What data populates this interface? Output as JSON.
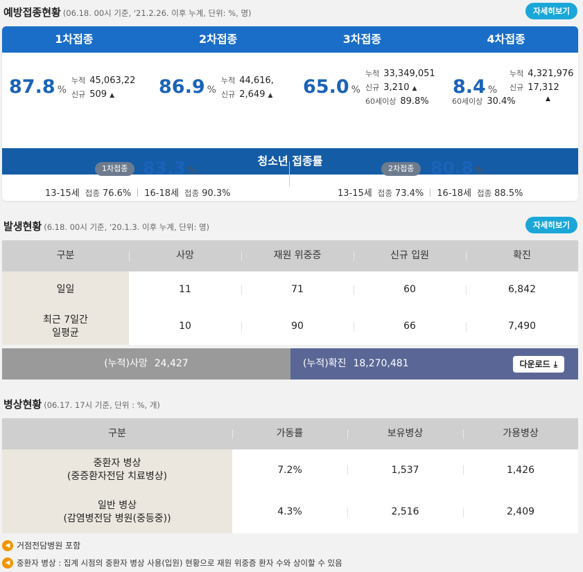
{
  "vaccination": {
    "title": "예방접종현황",
    "subtitle": "(06.18. 00시 기준, '21.2.26. 이후 누계, 단위: %, 명)",
    "detail_label": "자세히보기",
    "doses": [
      {
        "label": "1차접종",
        "rate": "87.8",
        "pct": "%",
        "cum_label": "누적",
        "cum": "45,063,22",
        "new_label": "신규",
        "new": "509"
      },
      {
        "label": "2차접종",
        "rate": "86.9",
        "pct": "%",
        "cum_label": "누적",
        "cum": "44,616,",
        "new_label": "신규",
        "new": "2,649"
      },
      {
        "label": "3차접종",
        "rate": "65.0",
        "pct": "%",
        "cum_label": "누적",
        "cum": "33,349,051",
        "new_label": "신규",
        "new": "3,210",
        "age_label": "60세이상",
        "age_rate": "89.8%"
      },
      {
        "label": "4차접종",
        "rate": "8.4",
        "pct": "%",
        "cum_label": "누적",
        "cum": "4,321,976",
        "new_label": "신규",
        "new": "17,312",
        "age_label": "60세이상",
        "age_rate": "30.4%"
      }
    ],
    "teen": {
      "title": "청소년 접종률",
      "groups": [
        {
          "badge": "1차접종",
          "rate": "83.3",
          "pct": "%",
          "a_age": "13-15세",
          "a_lbl": "접종",
          "a_val": "76.6%",
          "b_age": "16-18세",
          "b_lbl": "접종",
          "b_val": "90.3%"
        },
        {
          "badge": "2차접종",
          "rate": "80.8",
          "pct": "%",
          "a_age": "13-15세",
          "a_lbl": "접종",
          "a_val": "73.4%",
          "b_age": "16-18세",
          "b_lbl": "접종",
          "b_val": "88.5%"
        }
      ]
    }
  },
  "occurrence": {
    "title": "발생현황",
    "subtitle": "(6.18. 00시 기준, '20.1.3. 이후 누계, 단위: 명)",
    "detail_label": "자세히보기",
    "headers": [
      "구분",
      "사망",
      "재원 위중증",
      "신규 입원",
      "확진"
    ],
    "rows": [
      {
        "label": "일일",
        "values": [
          "11",
          "71",
          "60",
          "6,842"
        ]
      },
      {
        "label": "최근 7일간\n일평균",
        "values": [
          "10",
          "90",
          "66",
          "7,490"
        ]
      }
    ],
    "total_death_label": "(누적)사망",
    "total_death": "24,427",
    "total_conf_label": "(누적)확진",
    "total_conf": "18,270,481",
    "download_label": "다운로드"
  },
  "beds": {
    "title": "병상현황",
    "subtitle": "(06.17. 17시 기준, 단위 : %, 개)",
    "headers": [
      "구분",
      "가동률",
      "보유병상",
      "가용병상"
    ],
    "rows": [
      {
        "label": "중환자 병상\n(중증환자전담 치료병상)",
        "values": [
          "7.2%",
          "1,537",
          "1,426"
        ]
      },
      {
        "label": "일반 병상\n(감염병전담 병원(중등중))",
        "values": [
          "4.3%",
          "2,516",
          "2,409"
        ]
      }
    ]
  },
  "notes": [
    "거점전담병원 포함",
    "중환자 병상 : 집계 시점의 중환자 병상 사용(입원) 현황으로 재원 위중증 환자 수와 상이할 수 있음"
  ]
}
